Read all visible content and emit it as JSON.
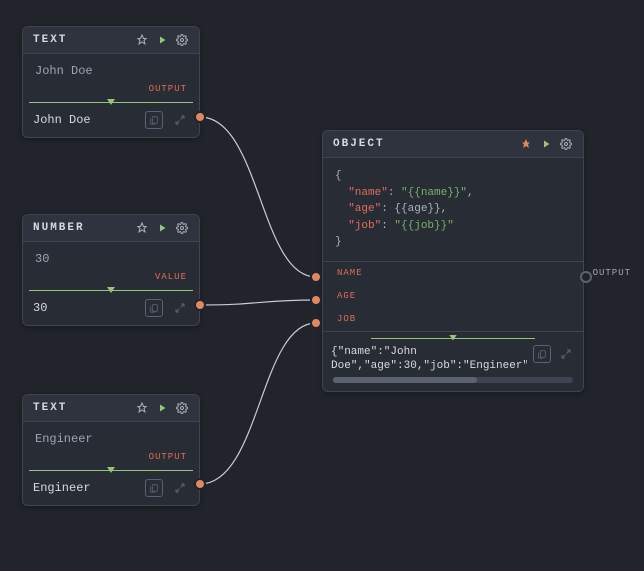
{
  "nodes": {
    "text1": {
      "title": "TEXT",
      "value": "John Doe",
      "outLabel": "OUTPUT",
      "result": "John Doe"
    },
    "number": {
      "title": "NUMBER",
      "value": "30",
      "outLabel": "VALUE",
      "result": "30"
    },
    "text2": {
      "title": "TEXT",
      "value": "Engineer",
      "outLabel": "OUTPUT",
      "result": "Engineer"
    },
    "object": {
      "title": "OBJECT",
      "template": {
        "open": "{",
        "l1a": "  \"name\"",
        "l1b": ": ",
        "l1c": "\"{{name}}\"",
        "l1d": ",",
        "l2a": "  \"age\"",
        "l2b": ": ",
        "l2c": "{{age}}",
        "l2d": ",",
        "l3a": "  \"job\"",
        "l3b": ": ",
        "l3c": "\"{{job}}\"",
        "l3d": "",
        "close": "}"
      },
      "inputs": {
        "name": "NAME",
        "age": "AGE",
        "job": "JOB"
      },
      "outLabel": "OUTPUT",
      "result": "{\"name\":\"John Doe\",\"age\":30,\"job\":\"Engineer\"}"
    }
  }
}
